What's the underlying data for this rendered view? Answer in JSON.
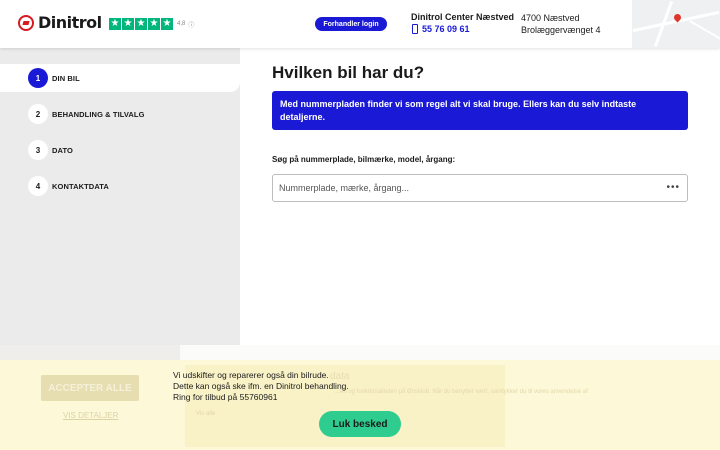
{
  "brand": {
    "name": "Dinitrol",
    "trust_score": "4,8"
  },
  "header": {
    "dealer_login": "Forhandler login",
    "center_name": "Dinitrol Center Næstved",
    "phone": "55 76 09 61",
    "address_line1": "4700 Næstved",
    "address_line2": "Brolæggervænget 4"
  },
  "steps": [
    {
      "num": "1",
      "label": "DIN BIL"
    },
    {
      "num": "2",
      "label": "BEHANDLING & TILVALG"
    },
    {
      "num": "3",
      "label": "DATO"
    },
    {
      "num": "4",
      "label": "KONTAKTDATA"
    }
  ],
  "main": {
    "title": "Hvilken bil har du?",
    "info": "Med nummerpladen finder vi som regel alt vi skal bruge. Ellers kan du selv indtaste detaljerne.",
    "search_label": "Søg på nummerplade, bilmærke, model, årgang:",
    "search_placeholder": "Nummerplade, mærke, årgang...",
    "search_value": ""
  },
  "cookie": {
    "accept": "ACCEPTER ALLE",
    "details": "VIS DETALJER",
    "heading": "data",
    "body": "...en og funktionaliteten på Ønsklub. Når du benytter vært, samtykker du til vores anvendelse af",
    "more": "Vis alle"
  },
  "message": {
    "line1": "Vi udskifter og reparerer også din bilrude.",
    "line2": "Dette kan også ske ifm. en Dinitrol behandling.",
    "line3": "Ring for tilbud på 55760961",
    "close": "Luk besked"
  },
  "colors": {
    "primary": "#1a1ad6",
    "trust_green": "#00b67a",
    "close_green": "#2ecc8f",
    "brand_red": "#d71920"
  }
}
